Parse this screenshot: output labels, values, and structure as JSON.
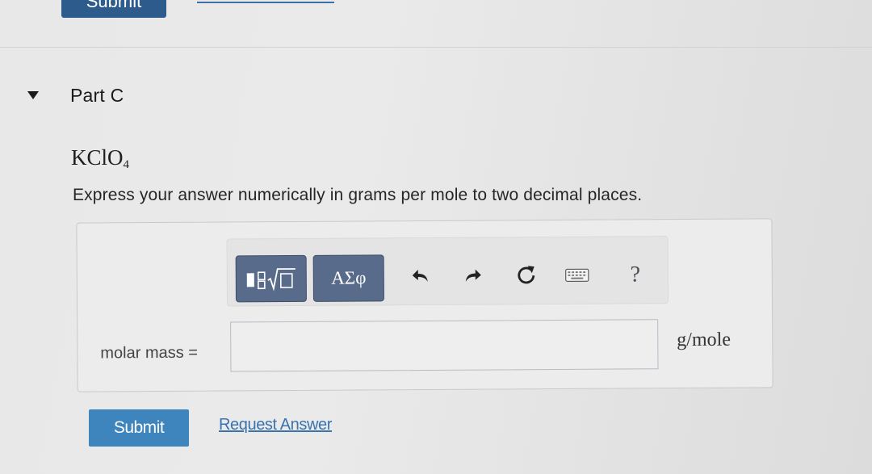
{
  "part": {
    "title": "Part C",
    "formula_main": "KClO",
    "formula_sub": "4",
    "instruction": "Express your answer numerically in grams per mole to two decimal places."
  },
  "top": {
    "submit_label": "Submit"
  },
  "toolbar": {
    "templates_icon": "templates-sqrt-icon",
    "greek_label": "ΑΣφ",
    "undo_icon": "undo-icon",
    "redo_icon": "redo-icon",
    "reset_icon": "reset-icon",
    "keyboard_icon": "keyboard-icon",
    "help_label": "?"
  },
  "answer": {
    "label": "molar mass =",
    "value": "",
    "placeholder": "",
    "units": "g/mole"
  },
  "actions": {
    "submit_label": "Submit",
    "request_label": "Request Answer"
  },
  "colors": {
    "submit_bg": "#3f85bd",
    "toolbar_btn_bg": "#586b8a",
    "link": "#3a73ae"
  }
}
